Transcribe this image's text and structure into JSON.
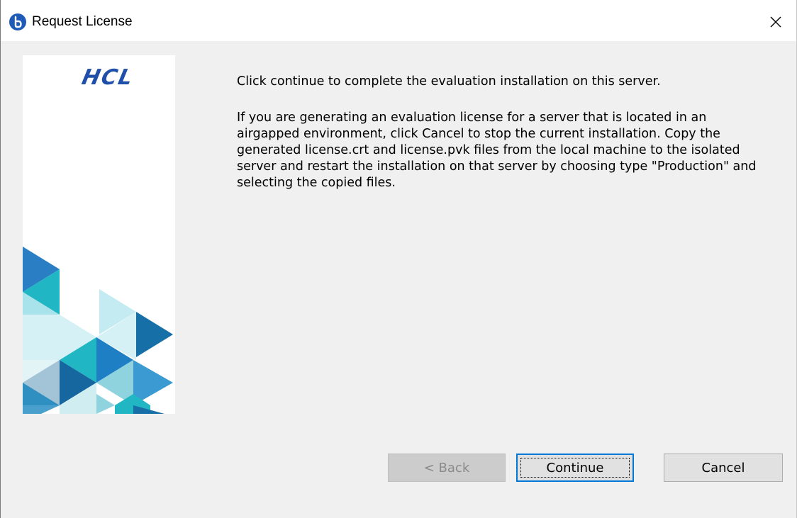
{
  "window": {
    "title": "Request License",
    "app_icon": "app-logo-icon",
    "close_icon": "close-icon"
  },
  "logo": {
    "wordmark": "HCL",
    "brand_color": "#1f4fa8"
  },
  "message": {
    "lead": "Click continue to complete the evaluation installation on this server.",
    "detail": "If you are generating an evaluation license for a server that is located in an airgapped environment, click Cancel to stop the current installation. Copy the generated license.crt and license.pvk files from the local machine to the isolated server and restart the installation on that server by choosing type \"Production\" and selecting the copied files."
  },
  "buttons": {
    "back": "< Back",
    "back_enabled": false,
    "continue": "Continue",
    "continue_focused": true,
    "cancel": "Cancel"
  },
  "colors": {
    "accent": "#0078d7",
    "window_bg": "#f0f0f0"
  }
}
